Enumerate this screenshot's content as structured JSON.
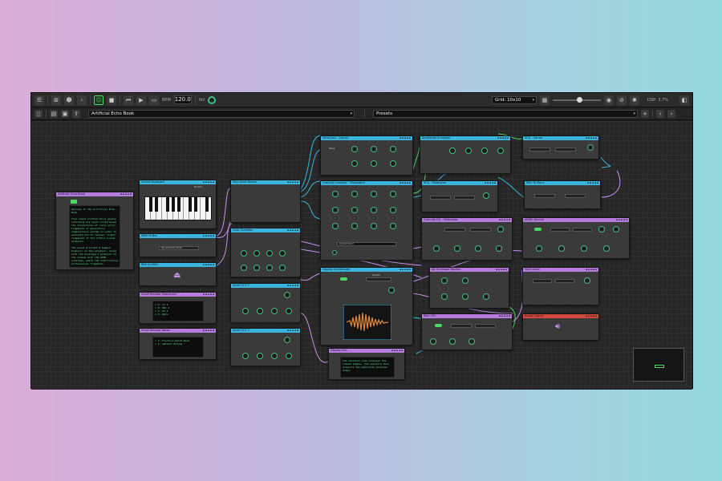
{
  "toolbar": {
    "bpm_label": "BPM",
    "bpm_value": "120.0",
    "vol_label": "Vol",
    "grid_value": "Grid: 10x10",
    "dsp": "DSP: 3.7%"
  },
  "toolbar2": {
    "patch_name": "Artificial Echo Book",
    "presets": "Presets"
  },
  "nodes": {
    "echo_book": {
      "title": "Artificial Echo Book",
      "text": "Welcome to the Artificial Echo Book.\n\nThis sound-crafted story gently unfolding any topic-constrained the collections of \"very story\" fragments of generative compositions wanted in order to evaluate and to recover \"sight\" fragments of the little closed elements.\n\nThe sound provided a Sample Granular on the playback, along with the envelope's granular on the random with the ADSR envelope, where the interlocking professional fragments."
    },
    "virtual_keyboard": {
      "title": "Virtual Keyboard",
      "label": "Monitor"
    },
    "midi_filter": {
      "title": "MIDI HI-Bus",
      "value": "Bypass/Select Mode"
    },
    "midi_output": {
      "title": "Midi to MIDI"
    },
    "sequencer_left": {
      "title": "Small Remote Sequencer",
      "text": "> A: C2 1\n> B: D#3 2\n> C: G3 3\n> D: Note"
    },
    "sequencer_notes": {
      "title": "Small Remote Notes",
      "text": "> 1: Function-Patch-Bank\n> 2: Ambient Echoes"
    },
    "poly_voice": {
      "title": "Poly Voice Router"
    },
    "synth_a": {
      "title": "Dual Oscillator"
    },
    "lfo_a": {
      "title": "Small LFO 1"
    },
    "lfo_b": {
      "title": "Small LFO 2"
    },
    "send_gen": {
      "title": "Send Gen - Carrier",
      "label": "Noise"
    },
    "sample_mod": {
      "title": "Granular Sampler - Modulated",
      "value": "Bypass/Select"
    },
    "display_rec": {
      "title": "Display Synthesizer",
      "label": "Sample"
    },
    "display_text": {
      "title": "Display Info",
      "text": "The waveform view displays the loaded sample. The waveform then presents the amplitude envelope shape."
    },
    "amp_env": {
      "title": "Amplitude Envelope"
    },
    "vca_mod": {
      "title": "VCA - Modulator"
    },
    "adsr_mod": {
      "title": "Granular EQ - Modulator"
    },
    "ad_envelope": {
      "title": "AD Envelope Nested"
    },
    "mod_lfo": {
      "title": "Mod LFO"
    },
    "vca_carrier": {
      "title": "VCA - Carrier"
    },
    "poly_to_mono": {
      "title": "Poly To Mono"
    },
    "adsr_volume": {
      "title": "ADSR Volume"
    },
    "reverb_ctrl": {
      "title": "Multi Level"
    },
    "audio_output": {
      "title": "Audio Output"
    }
  }
}
